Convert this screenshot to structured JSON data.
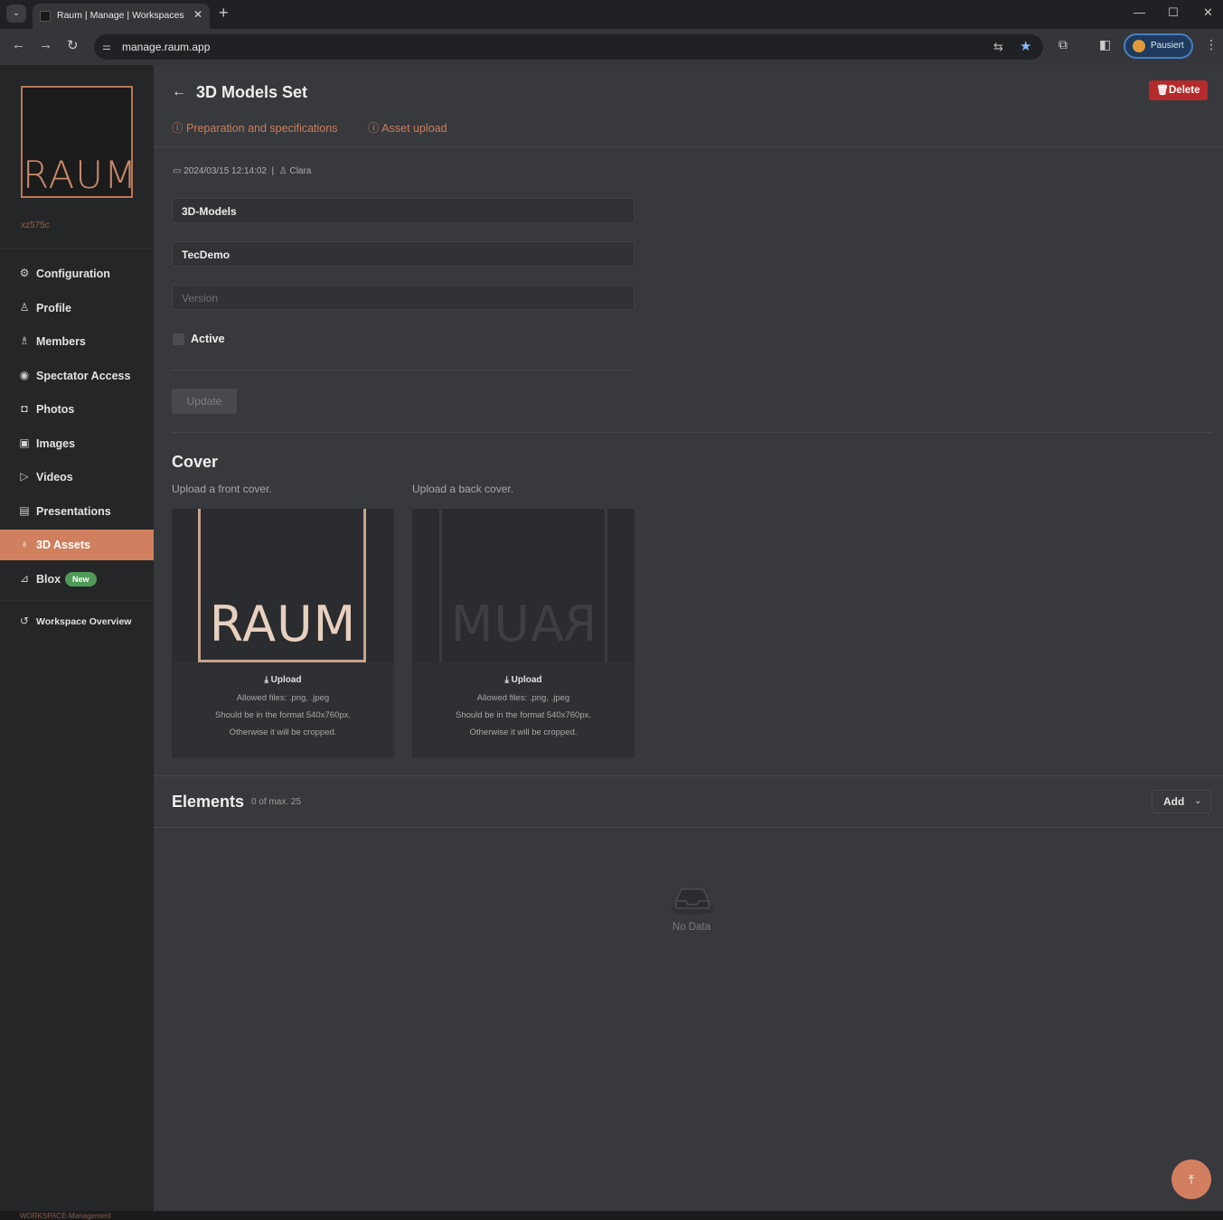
{
  "browser": {
    "tab_title": "Raum | Manage | Workspaces",
    "url": "manage.raum.app",
    "profile_label": "Pausiert"
  },
  "sidebar": {
    "logo_text": "RAUM",
    "workspace_id": "xz575c",
    "items": [
      {
        "label": "Configuration",
        "icon": "gear-icon"
      },
      {
        "label": "Profile",
        "icon": "user-icon"
      },
      {
        "label": "Members",
        "icon": "members-icon"
      },
      {
        "label": "Spectator Access",
        "icon": "eye-icon"
      },
      {
        "label": "Photos",
        "icon": "camera-icon"
      },
      {
        "label": "Images",
        "icon": "image-icon"
      },
      {
        "label": "Videos",
        "icon": "video-icon"
      },
      {
        "label": "Presentations",
        "icon": "presentation-icon"
      },
      {
        "label": "3D Assets",
        "icon": "cube-icon",
        "active": true
      },
      {
        "label": "Blox",
        "icon": "blox-icon",
        "badge": "New"
      }
    ],
    "overview_label": "Workspace Overview"
  },
  "header": {
    "title": "3D Models Set",
    "delete_label": "Delete",
    "link_prep": "Preparation and specifications",
    "link_upload": "Asset upload"
  },
  "meta": {
    "date": "2024/03/15 12:14:02",
    "author": "Clara"
  },
  "form": {
    "category": "3D-Models",
    "name": "TecDemo",
    "version_placeholder": "Version",
    "active_label": "Active",
    "active_checked": false,
    "update_label": "Update"
  },
  "cover": {
    "title": "Cover",
    "front_hint": "Upload a front cover.",
    "back_hint": "Upload a back cover.",
    "upload_label": "Upload",
    "allowed": "Allowed files: .png, .jpeg",
    "format": "Should be in the format 540x760px.",
    "crop": "Otherwise it will be cropped."
  },
  "elements": {
    "title": "Elements",
    "count": "0 of max. 25",
    "add_label": "Add",
    "empty_text": "No Data"
  },
  "statusbar": {
    "text": "WORKSPACE-Management"
  },
  "colors": {
    "accent": "#d0805f",
    "delete": "#b52a2a",
    "badge_new": "#4f9a57"
  }
}
